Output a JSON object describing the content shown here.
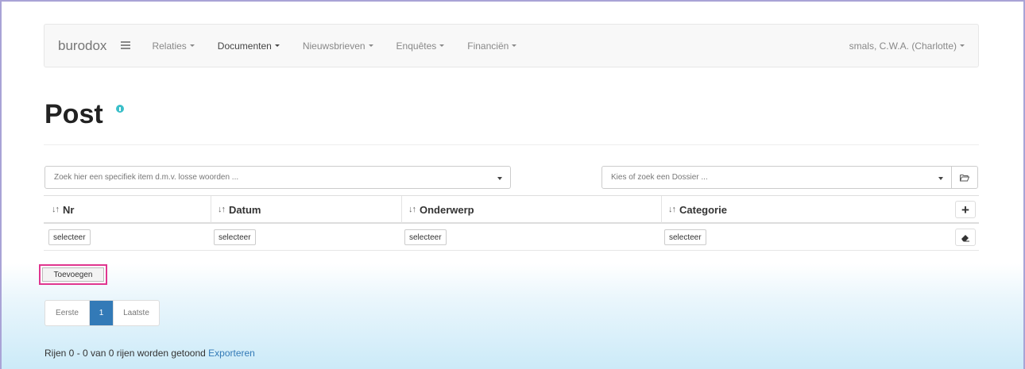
{
  "navbar": {
    "brand": "burodox",
    "items": [
      {
        "label": "Relaties"
      },
      {
        "label": "Documenten"
      },
      {
        "label": "Nieuwsbrieven"
      },
      {
        "label": "Enquêtes"
      },
      {
        "label": "Financiën"
      }
    ],
    "user": "smals, C.W.A. (Charlotte)"
  },
  "page": {
    "title": "Post"
  },
  "search": {
    "item_placeholder": "Zoek hier een specifiek item d.m.v. losse woorden ...",
    "dossier_placeholder": "Kies of zoek een Dossier ..."
  },
  "table": {
    "columns": [
      "Nr",
      "Datum",
      "Onderwerp",
      "Categorie"
    ],
    "sort_glyph": "↓↑",
    "filter_label": "selecteer",
    "add_icon": "+",
    "filter_icon": "eraser-icon"
  },
  "actions": {
    "add_label": "Toevoegen"
  },
  "pagination": {
    "first": "Eerste",
    "current": "1",
    "last": "Laatste"
  },
  "footer": {
    "summary": "Rijen 0 - 0 van 0 rijen worden getoond ",
    "export": "Exporteren"
  },
  "colors": {
    "accent": "#337ab7",
    "info": "#3bbfc9",
    "highlight": "#e0368f"
  }
}
